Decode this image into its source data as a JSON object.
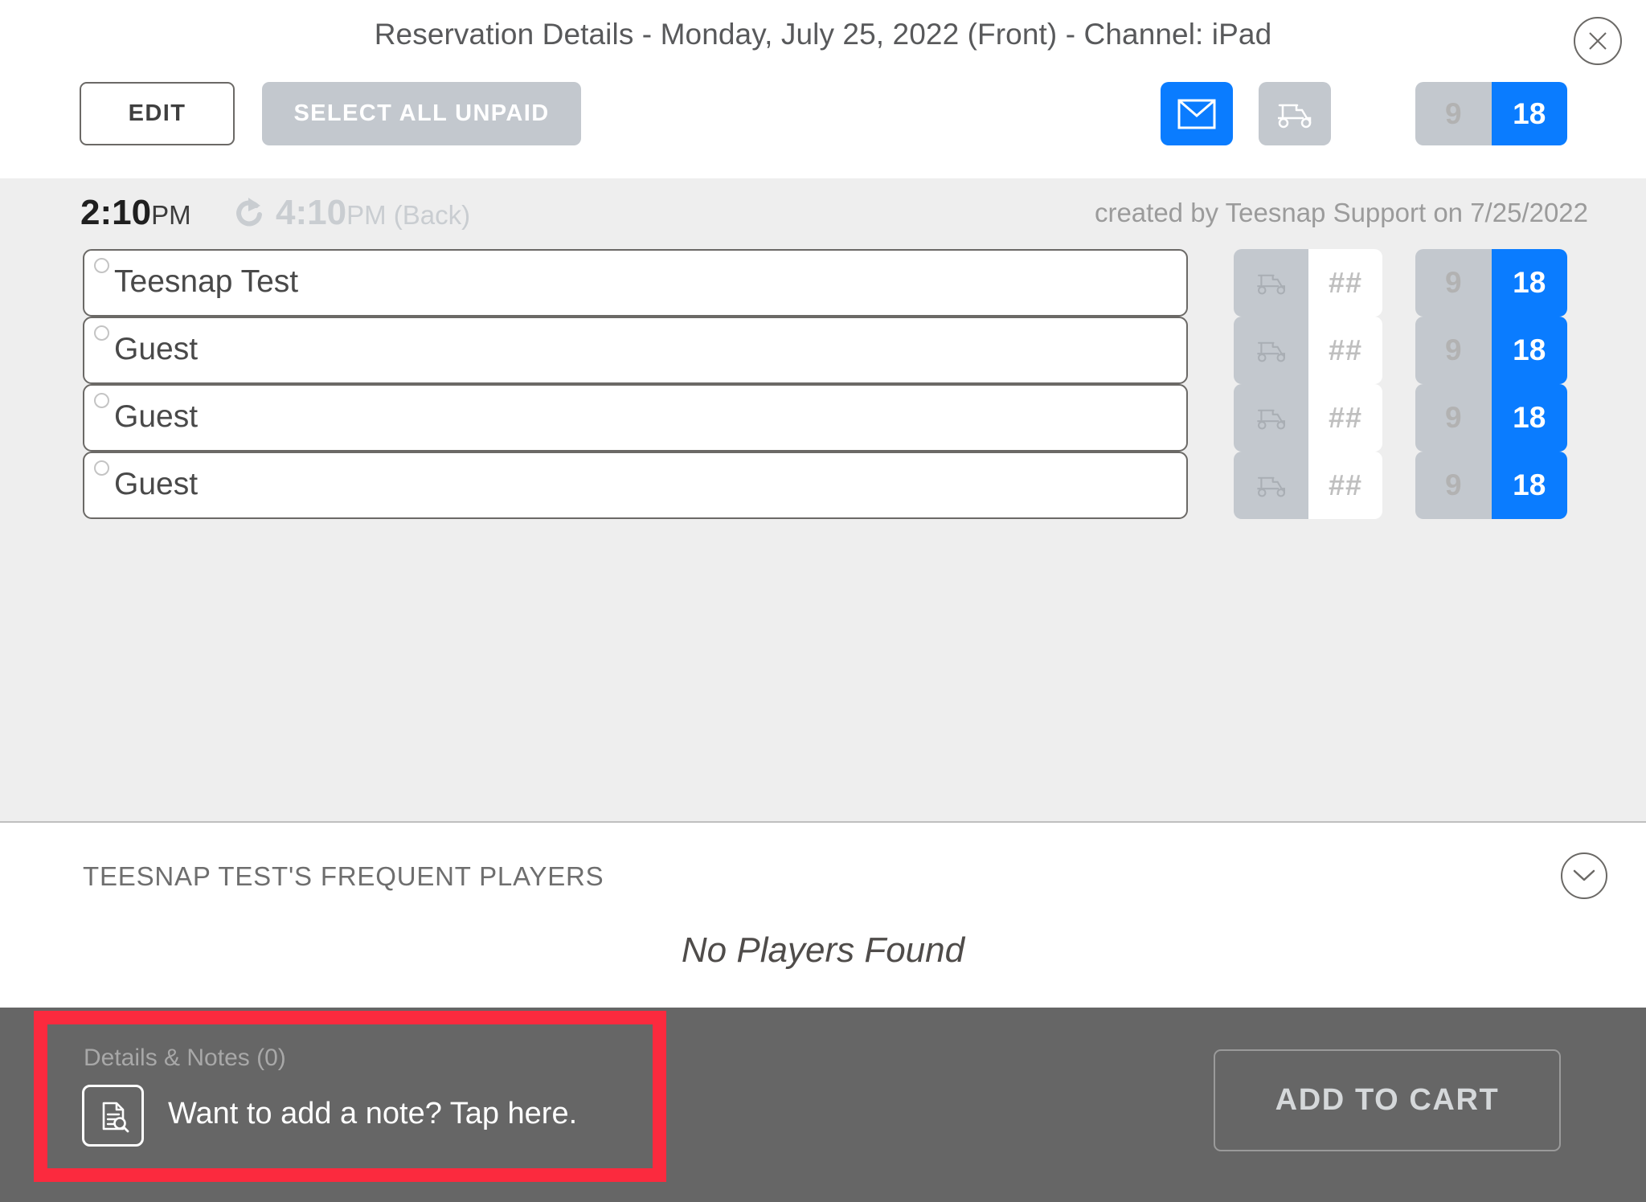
{
  "header": {
    "title": "Reservation Details - Monday, July 25, 2022 (Front) - Channel: iPad",
    "close_icon": "close-icon",
    "toolbar": {
      "edit_label": "EDIT",
      "select_all_unpaid_label": "SELECT ALL UNPAID",
      "mail_icon": "envelope-icon",
      "cart_icon": "golf-cart-icon",
      "holes_toggle": {
        "option_nine": "9",
        "option_eighteen": "18",
        "selected": "18"
      }
    }
  },
  "reservation": {
    "start_time": "2:10",
    "start_ampm": "PM",
    "back_arrow_icon": "redo-arrow-icon",
    "back_time": "4:10",
    "back_ampm": "PM (Back)",
    "created_by": "created by Teesnap Support on 7/25/2022",
    "cart_placeholder": "##",
    "players": [
      {
        "name": "Teesnap Test",
        "cart_value": "##",
        "holes": "18"
      },
      {
        "name": "Guest",
        "cart_value": "##",
        "holes": "18"
      },
      {
        "name": "Guest",
        "cart_value": "##",
        "holes": "18"
      },
      {
        "name": "Guest",
        "cart_value": "##",
        "holes": "18"
      }
    ]
  },
  "frequent_players": {
    "title": "TEESNAP TEST'S FREQUENT PLAYERS",
    "chevron_icon": "chevron-down-icon",
    "empty_message": "No Players Found"
  },
  "footer": {
    "notes_label": "Details & Notes (0)",
    "notes_icon": "document-search-icon",
    "notes_prompt": "Want to add a note? Tap here.",
    "add_to_cart_label": "ADD TO CART"
  },
  "colors": {
    "accent_blue": "#0a7cff",
    "muted_gray": "#c3c8ce",
    "highlight_red": "#fb2a3e",
    "footer_gray": "#666666",
    "list_bg": "#eeeeee"
  }
}
